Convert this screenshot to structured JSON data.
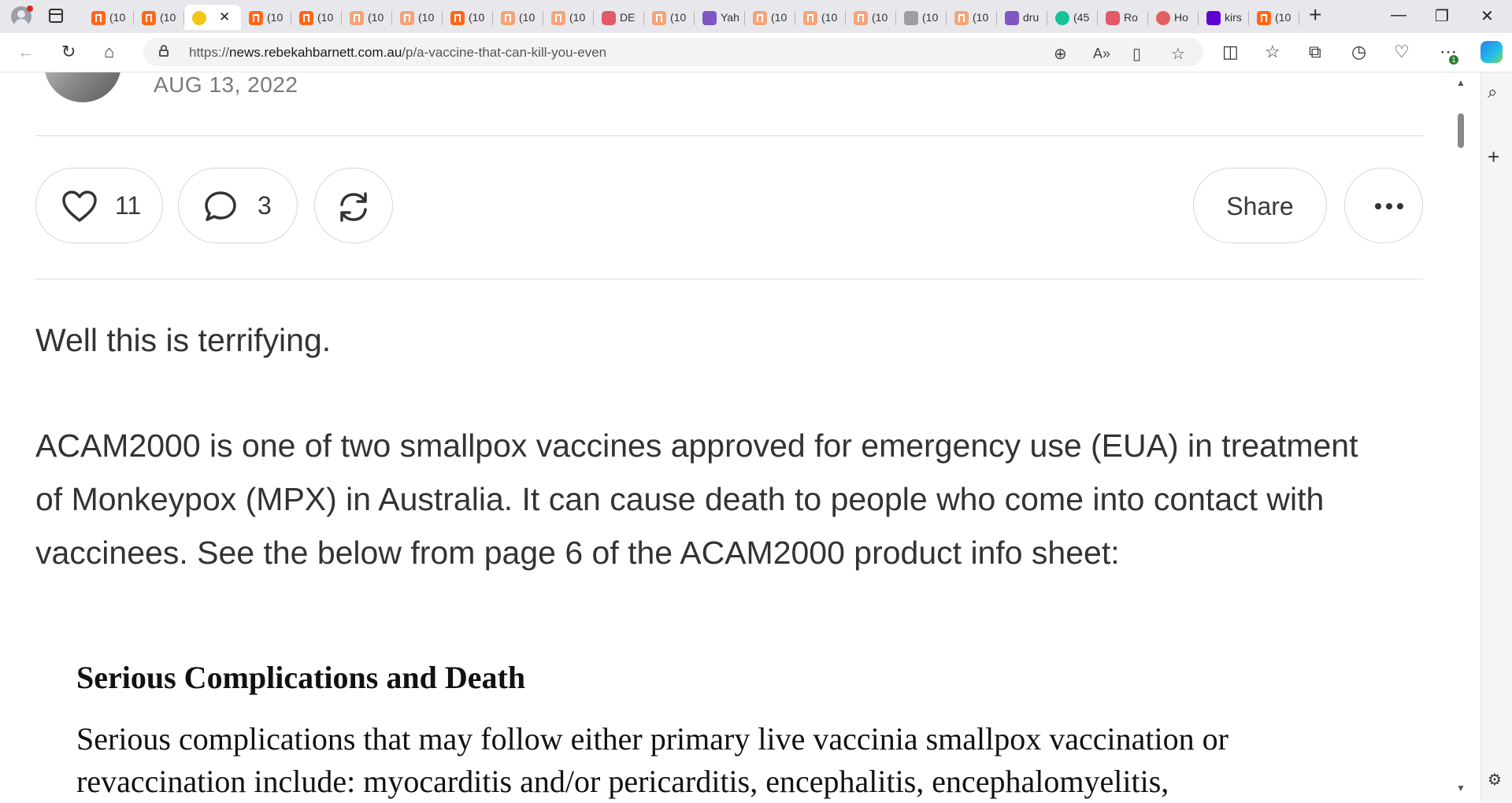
{
  "browser": {
    "tabs": [
      {
        "title": "(10",
        "icon": "substack-icon",
        "kind": "substack"
      },
      {
        "title": "(10",
        "icon": "substack-icon",
        "kind": "substack"
      },
      {
        "title": "",
        "icon": "emoji-icon",
        "kind": "emoji",
        "active": true
      },
      {
        "title": "(10",
        "icon": "substack-icon",
        "kind": "substack"
      },
      {
        "title": "(10",
        "icon": "substack-icon",
        "kind": "substack"
      },
      {
        "title": "(10",
        "icon": "substack-icon",
        "kind": "substack-faded"
      },
      {
        "title": "(10",
        "icon": "substack-icon",
        "kind": "substack-faded"
      },
      {
        "title": "(10",
        "icon": "substack-icon",
        "kind": "substack"
      },
      {
        "title": "(10",
        "icon": "substack-icon",
        "kind": "substack-faded"
      },
      {
        "title": "(10",
        "icon": "substack-icon",
        "kind": "substack-faded"
      },
      {
        "title": "DE",
        "icon": "youtube-icon",
        "kind": "yt"
      },
      {
        "title": "(10",
        "icon": "substack-icon",
        "kind": "substack-faded"
      },
      {
        "title": "Yah",
        "icon": "yahoo-icon",
        "kind": "yahoo"
      },
      {
        "title": "(10",
        "icon": "substack-icon",
        "kind": "substack-faded"
      },
      {
        "title": "(10",
        "icon": "substack-icon",
        "kind": "substack-faded"
      },
      {
        "title": "(10",
        "icon": "substack-icon",
        "kind": "substack-faded"
      },
      {
        "title": "(10",
        "icon": "photo-icon",
        "kind": "photo"
      },
      {
        "title": "(10",
        "icon": "substack-icon",
        "kind": "substack-faded"
      },
      {
        "title": "dru",
        "icon": "yahoo-icon",
        "kind": "yahoo"
      },
      {
        "title": "(45",
        "icon": "grammarly-icon",
        "kind": "grammarly"
      },
      {
        "title": "Ro",
        "icon": "youtube-icon",
        "kind": "yt"
      },
      {
        "title": "Ho",
        "icon": "profile-red-icon",
        "kind": "red"
      },
      {
        "title": "kirs",
        "icon": "yahoo-icon",
        "kind": "yahoo2"
      },
      {
        "title": "(10",
        "icon": "substack-icon",
        "kind": "substack"
      }
    ],
    "url_prefix": "https://",
    "url_host": "news.rebekahbarnett.com.au",
    "url_path": "/p/a-vaccine-that-can-kill-you-even",
    "extension_badge": "1"
  },
  "post": {
    "date": "AUG 13, 2022",
    "like_count": "11",
    "comment_count": "3",
    "share_label": "Share",
    "paragraph1": "Well this is terrifying.",
    "paragraph2_lines": [
      "ACAM2000 is one of two smallpox vaccines approved for emergency use (EUA) in treatment",
      "of Monkeypox (MPX) in Australia. It can cause death to people who come into contact with",
      "vaccinees. See the below from page 6 of the ACAM2000 product info sheet:"
    ],
    "excerpt_heading": "Serious Complications and Death",
    "excerpt_lines": [
      "Serious complications that may follow either primary live vaccinia smallpox vaccination or",
      "revaccination include: myocarditis and/or pericarditis, encephalitis, encephalomyelitis,"
    ]
  }
}
